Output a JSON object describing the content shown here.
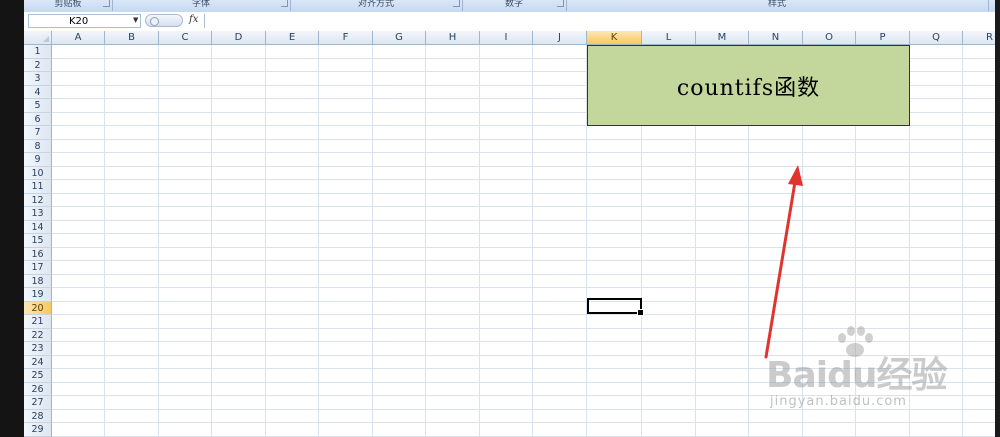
{
  "ribbon": {
    "groups": [
      "剪贴板",
      "字体",
      "对齐方式",
      "数字",
      "样式"
    ]
  },
  "formula_bar": {
    "name_box": "K20",
    "fx_label": "fx",
    "formula": ""
  },
  "sheet": {
    "columns": [
      "A",
      "B",
      "C",
      "D",
      "E",
      "F",
      "G",
      "H",
      "I",
      "J",
      "K",
      "L",
      "M",
      "N",
      "O",
      "P",
      "Q",
      "R"
    ],
    "rows": [
      "1",
      "2",
      "3",
      "4",
      "5",
      "6",
      "7",
      "8",
      "9",
      "10",
      "11",
      "12",
      "13",
      "14",
      "15",
      "16",
      "17",
      "18",
      "19",
      "20",
      "21",
      "22",
      "23",
      "24",
      "25",
      "26",
      "27",
      "28",
      "29"
    ],
    "selected_column": "K",
    "selected_row": "20",
    "title_text": "countifs函数",
    "title_fill": "#c3d69b"
  },
  "annotation": {
    "arrow_color": "#e0342e"
  },
  "watermark": {
    "brand": "Baidu经验",
    "url": "jingyan.baidu.com"
  }
}
